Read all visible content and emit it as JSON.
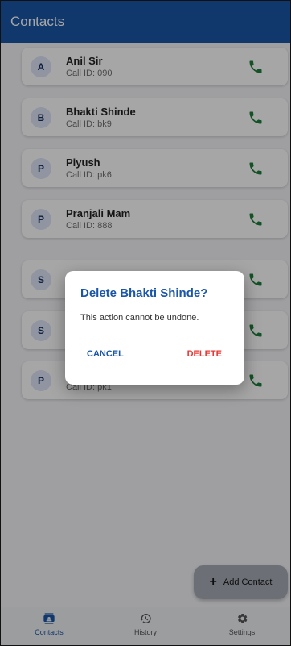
{
  "appbar": {
    "title": "Contacts"
  },
  "contacts": [
    {
      "initial": "A",
      "name": "Anil Sir",
      "call_id": "Call ID: 090"
    },
    {
      "initial": "B",
      "name": "Bhakti Shinde",
      "call_id": "Call ID: bk9"
    },
    {
      "initial": "P",
      "name": "Piyush",
      "call_id": "Call ID: pk6"
    },
    {
      "initial": "P",
      "name": "Pranjali Mam",
      "call_id": "Call ID: 888"
    },
    {
      "initial": "S",
      "name": "",
      "call_id": ""
    },
    {
      "initial": "S",
      "name": "",
      "call_id": ""
    },
    {
      "initial": "P",
      "name": "",
      "call_id": "Call ID: pk1"
    }
  ],
  "dialog": {
    "title": "Delete Bhakti Shinde?",
    "message": "This action cannot be undone.",
    "cancel_label": "CANCEL",
    "delete_label": "DELETE"
  },
  "fab": {
    "label": "Add Contact"
  },
  "bottom_nav": {
    "items": [
      {
        "label": "Contacts",
        "icon": "contacts-icon",
        "active": true
      },
      {
        "label": "History",
        "icon": "history-icon",
        "active": false
      },
      {
        "label": "Settings",
        "icon": "settings-icon",
        "active": false
      }
    ]
  },
  "colors": {
    "primary": "#1b56a8",
    "call_green": "#1e7d3b",
    "danger": "#e53935"
  }
}
